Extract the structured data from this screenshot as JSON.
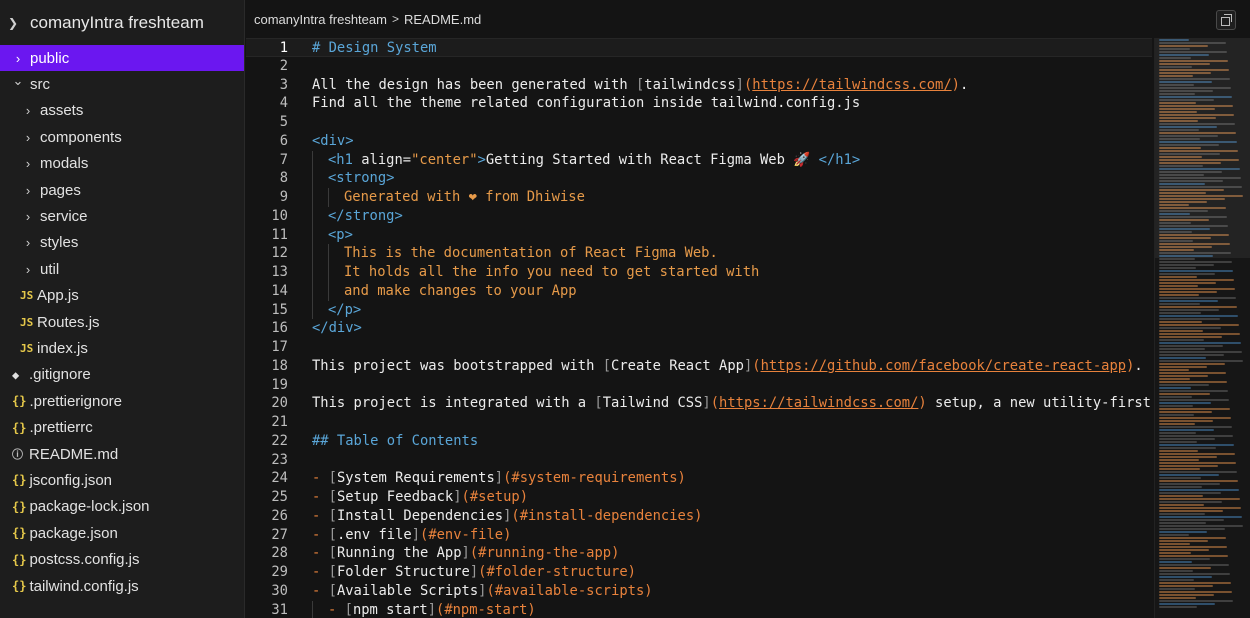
{
  "sidebar": {
    "root": "comanyIntra freshteam",
    "items": [
      {
        "label": "public",
        "type": "folder",
        "depth": 0,
        "expanded": false,
        "selected": true
      },
      {
        "label": "src",
        "type": "folder",
        "depth": 0,
        "expanded": true,
        "selected": false
      },
      {
        "label": "assets",
        "type": "folder",
        "depth": 1,
        "expanded": false
      },
      {
        "label": "components",
        "type": "folder",
        "depth": 1,
        "expanded": false
      },
      {
        "label": "modals",
        "type": "folder",
        "depth": 1,
        "expanded": false
      },
      {
        "label": "pages",
        "type": "folder",
        "depth": 1,
        "expanded": false
      },
      {
        "label": "service",
        "type": "folder",
        "depth": 1,
        "expanded": false
      },
      {
        "label": "styles",
        "type": "folder",
        "depth": 1,
        "expanded": false
      },
      {
        "label": "util",
        "type": "folder",
        "depth": 1,
        "expanded": false
      },
      {
        "label": "App.js",
        "type": "js",
        "depth": 1
      },
      {
        "label": "Routes.js",
        "type": "js",
        "depth": 1
      },
      {
        "label": "index.js",
        "type": "js",
        "depth": 1
      },
      {
        "label": ".gitignore",
        "type": "git",
        "depth": 0
      },
      {
        "label": ".prettierignore",
        "type": "json",
        "depth": 0
      },
      {
        "label": ".prettierrc",
        "type": "json",
        "depth": 0
      },
      {
        "label": "README.md",
        "type": "info",
        "depth": 0
      },
      {
        "label": "jsconfig.json",
        "type": "json",
        "depth": 0
      },
      {
        "label": "package-lock.json",
        "type": "json",
        "depth": 0
      },
      {
        "label": "package.json",
        "type": "json",
        "depth": 0
      },
      {
        "label": "postcss.config.js",
        "type": "json",
        "depth": 0
      },
      {
        "label": "tailwind.config.js",
        "type": "json",
        "depth": 0
      }
    ]
  },
  "breadcrumb": {
    "project": "comanyIntra freshteam",
    "file": "README.md"
  },
  "editor": {
    "lines": [
      {
        "n": "1",
        "current": true,
        "indent": 0,
        "tokens": [
          [
            "c-head",
            "# Design System"
          ]
        ]
      },
      {
        "n": "2",
        "indent": 0,
        "tokens": []
      },
      {
        "n": "3",
        "indent": 0,
        "tokens": [
          [
            "c-white",
            "All the design has been generated with "
          ],
          [
            "c-br",
            "["
          ],
          [
            "c-white",
            "tailwindcss"
          ],
          [
            "c-br",
            "]"
          ],
          [
            "c-orange",
            "("
          ],
          [
            "c-url",
            "https://tailwindcss.com/"
          ],
          [
            "c-orange",
            ")"
          ],
          [
            "c-white",
            "."
          ]
        ]
      },
      {
        "n": "4",
        "indent": 0,
        "tokens": [
          [
            "c-white",
            "Find all the theme related configuration inside tailwind.config.js"
          ]
        ]
      },
      {
        "n": "5",
        "indent": 0,
        "tokens": []
      },
      {
        "n": "6",
        "indent": 0,
        "tokens": [
          [
            "c-tag",
            "<div>"
          ]
        ]
      },
      {
        "n": "7",
        "indent": 1,
        "tokens": [
          [
            "c-tag",
            "<h1 "
          ],
          [
            "c-attr",
            "align="
          ],
          [
            "c-str",
            "\"center\""
          ],
          [
            "c-tag",
            ">"
          ],
          [
            "c-white",
            "Getting Started with React Figma Web 🚀 "
          ],
          [
            "c-tag",
            "</h1>"
          ]
        ]
      },
      {
        "n": "8",
        "indent": 1,
        "tokens": [
          [
            "c-tag",
            "<strong>"
          ]
        ]
      },
      {
        "n": "9",
        "indent": 2,
        "tokens": [
          [
            "c-str",
            "Generated with ❤ from Dhiwise"
          ]
        ]
      },
      {
        "n": "10",
        "indent": 1,
        "tokens": [
          [
            "c-tag",
            "</strong>"
          ]
        ]
      },
      {
        "n": "11",
        "indent": 1,
        "tokens": [
          [
            "c-tag",
            "<p>"
          ]
        ]
      },
      {
        "n": "12",
        "indent": 2,
        "tokens": [
          [
            "c-str",
            "This is the documentation of React Figma Web."
          ]
        ]
      },
      {
        "n": "13",
        "indent": 2,
        "tokens": [
          [
            "c-str",
            "It holds all the info you need to get started with"
          ]
        ]
      },
      {
        "n": "14",
        "indent": 2,
        "tokens": [
          [
            "c-str",
            "and make changes to your App"
          ]
        ]
      },
      {
        "n": "15",
        "indent": 1,
        "tokens": [
          [
            "c-tag",
            "</p>"
          ]
        ]
      },
      {
        "n": "16",
        "indent": 0,
        "tokens": [
          [
            "c-tag",
            "</div>"
          ]
        ]
      },
      {
        "n": "17",
        "indent": 0,
        "tokens": []
      },
      {
        "n": "18",
        "indent": 0,
        "tokens": [
          [
            "c-white",
            "This project was bootstrapped with "
          ],
          [
            "c-br",
            "["
          ],
          [
            "c-white",
            "Create React App"
          ],
          [
            "c-br",
            "]"
          ],
          [
            "c-orange",
            "("
          ],
          [
            "c-url",
            "https://github.com/facebook/create-react-app"
          ],
          [
            "c-orange",
            ")"
          ],
          [
            "c-white",
            "."
          ]
        ]
      },
      {
        "n": "19",
        "indent": 0,
        "tokens": []
      },
      {
        "n": "20",
        "indent": 0,
        "tokens": [
          [
            "c-white",
            "This project is integrated with a "
          ],
          [
            "c-br",
            "["
          ],
          [
            "c-white",
            "Tailwind CSS"
          ],
          [
            "c-br",
            "]"
          ],
          [
            "c-orange",
            "("
          ],
          [
            "c-url",
            "https://tailwindcss.com/"
          ],
          [
            "c-orange",
            ")"
          ],
          [
            "c-white",
            " setup, a new utility-first"
          ]
        ]
      },
      {
        "n": "21",
        "indent": 0,
        "tokens": []
      },
      {
        "n": "22",
        "indent": 0,
        "tokens": [
          [
            "c-head",
            "## Table of Contents"
          ]
        ]
      },
      {
        "n": "23",
        "indent": 0,
        "tokens": []
      },
      {
        "n": "24",
        "indent": 0,
        "tokens": [
          [
            "c-orange",
            "- "
          ],
          [
            "c-br",
            "["
          ],
          [
            "c-white",
            "System Requirements"
          ],
          [
            "c-br",
            "]"
          ],
          [
            "c-orange",
            "(#system-requirements)"
          ]
        ]
      },
      {
        "n": "25",
        "indent": 0,
        "tokens": [
          [
            "c-orange",
            "- "
          ],
          [
            "c-br",
            "["
          ],
          [
            "c-white",
            "Setup Feedback"
          ],
          [
            "c-br",
            "]"
          ],
          [
            "c-orange",
            "(#setup)"
          ]
        ]
      },
      {
        "n": "26",
        "indent": 0,
        "tokens": [
          [
            "c-orange",
            "- "
          ],
          [
            "c-br",
            "["
          ],
          [
            "c-white",
            "Install Dependencies"
          ],
          [
            "c-br",
            "]"
          ],
          [
            "c-orange",
            "(#install-dependencies)"
          ]
        ]
      },
      {
        "n": "27",
        "indent": 0,
        "tokens": [
          [
            "c-orange",
            "- "
          ],
          [
            "c-br",
            "["
          ],
          [
            "c-white",
            ".env file"
          ],
          [
            "c-br",
            "]"
          ],
          [
            "c-orange",
            "(#env-file)"
          ]
        ]
      },
      {
        "n": "28",
        "indent": 0,
        "tokens": [
          [
            "c-orange",
            "- "
          ],
          [
            "c-br",
            "["
          ],
          [
            "c-white",
            "Running the App"
          ],
          [
            "c-br",
            "]"
          ],
          [
            "c-orange",
            "(#running-the-app)"
          ]
        ]
      },
      {
        "n": "29",
        "indent": 0,
        "tokens": [
          [
            "c-orange",
            "- "
          ],
          [
            "c-br",
            "["
          ],
          [
            "c-white",
            "Folder Structure"
          ],
          [
            "c-br",
            "]"
          ],
          [
            "c-orange",
            "(#folder-structure)"
          ]
        ]
      },
      {
        "n": "30",
        "indent": 0,
        "tokens": [
          [
            "c-orange",
            "- "
          ],
          [
            "c-br",
            "["
          ],
          [
            "c-white",
            "Available Scripts"
          ],
          [
            "c-br",
            "]"
          ],
          [
            "c-orange",
            "(#available-scripts)"
          ]
        ]
      },
      {
        "n": "31",
        "indent": 1,
        "tokens": [
          [
            "c-orange",
            "- "
          ],
          [
            "c-br",
            "["
          ],
          [
            "c-white",
            "npm start"
          ],
          [
            "c-br",
            "]"
          ],
          [
            "c-orange",
            "(#npm-start)"
          ]
        ]
      }
    ]
  },
  "colors": {
    "selected": "#6b17f0",
    "heading": "#5aa6d8",
    "link": "#e8823c"
  }
}
